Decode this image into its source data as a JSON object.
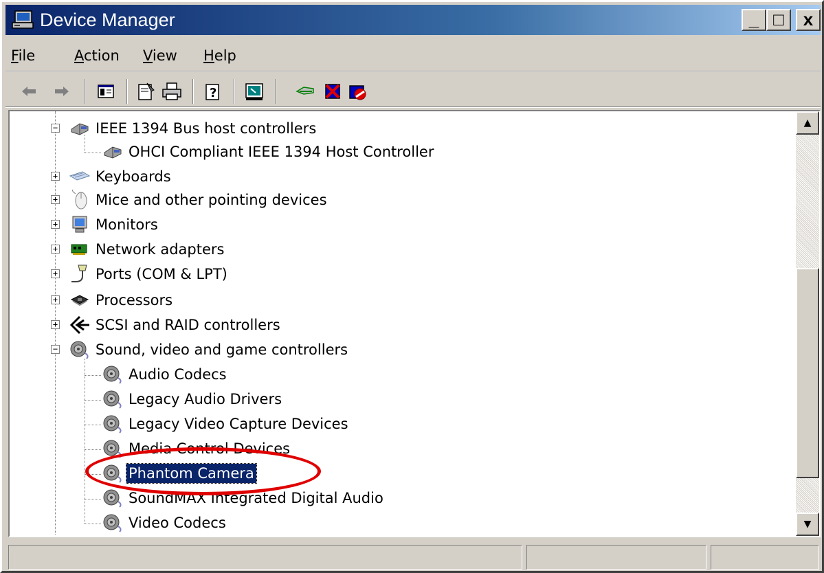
{
  "window": {
    "title": "Device Manager",
    "icon": "device-manager-icon",
    "controls": {
      "minimize": "_",
      "maximize": "□",
      "close": "x"
    }
  },
  "menu": [
    {
      "label_ul": "F",
      "label_rest": "ile"
    },
    {
      "label_ul": "A",
      "label_rest": "ction"
    },
    {
      "label_ul": "V",
      "label_rest": "iew"
    },
    {
      "label_ul": "H",
      "label_rest": "elp"
    }
  ],
  "toolbar": {
    "buttons": [
      "back-arrow-icon",
      "forward-arrow-icon",
      "show-hide-console-tree-icon",
      "properties-icon",
      "print-icon",
      "help-icon",
      "scan-hardware-icon",
      "update-driver-icon",
      "uninstall-icon",
      "disable-icon"
    ]
  },
  "tree": {
    "nodes": [
      {
        "label": "IEEE 1394 Bus host controllers",
        "level": 1,
        "expander": "−",
        "icon": "ieee1394-icon"
      },
      {
        "label": "OHCI Compliant IEEE 1394 Host Controller",
        "level": 2,
        "expander": "",
        "icon": "ieee1394-icon"
      },
      {
        "label": "Keyboards",
        "level": 1,
        "expander": "+",
        "icon": "keyboard-icon"
      },
      {
        "label": "Mice and other pointing devices",
        "level": 1,
        "expander": "+",
        "icon": "mouse-icon"
      },
      {
        "label": "Monitors",
        "level": 1,
        "expander": "+",
        "icon": "monitor-icon"
      },
      {
        "label": "Network adapters",
        "level": 1,
        "expander": "+",
        "icon": "network-adapter-icon"
      },
      {
        "label": "Ports (COM & LPT)",
        "level": 1,
        "expander": "+",
        "icon": "port-icon"
      },
      {
        "label": "Processors",
        "level": 1,
        "expander": "+",
        "icon": "processor-icon"
      },
      {
        "label": "SCSI and RAID controllers",
        "level": 1,
        "expander": "+",
        "icon": "scsi-icon"
      },
      {
        "label": "Sound, video and game controllers",
        "level": 1,
        "expander": "−",
        "icon": "speaker-icon"
      },
      {
        "label": "Audio Codecs",
        "level": 2,
        "expander": "",
        "icon": "speaker-icon"
      },
      {
        "label": "Legacy Audio Drivers",
        "level": 2,
        "expander": "",
        "icon": "speaker-icon"
      },
      {
        "label": "Legacy Video Capture Devices",
        "level": 2,
        "expander": "",
        "icon": "speaker-icon"
      },
      {
        "label": "Media Control Devices",
        "level": 2,
        "expander": "",
        "icon": "speaker-icon"
      },
      {
        "label": "Phantom Camera",
        "level": 2,
        "expander": "",
        "icon": "speaker-icon",
        "selected": true
      },
      {
        "label": "SoundMAX Integrated Digital Audio",
        "level": 2,
        "expander": "",
        "icon": "speaker-icon"
      },
      {
        "label": "Video Codecs",
        "level": 2,
        "expander": "",
        "icon": "speaker-icon"
      }
    ]
  },
  "scrollbar": {
    "up": "▲",
    "down": "▼"
  },
  "status": {
    "panel1": "",
    "panel2": "",
    "panel3": ""
  },
  "colors": {
    "titlebar": "#0a246a",
    "selection": "#0a246a",
    "annotation": "#e00000",
    "face": "#d4d0c8"
  }
}
